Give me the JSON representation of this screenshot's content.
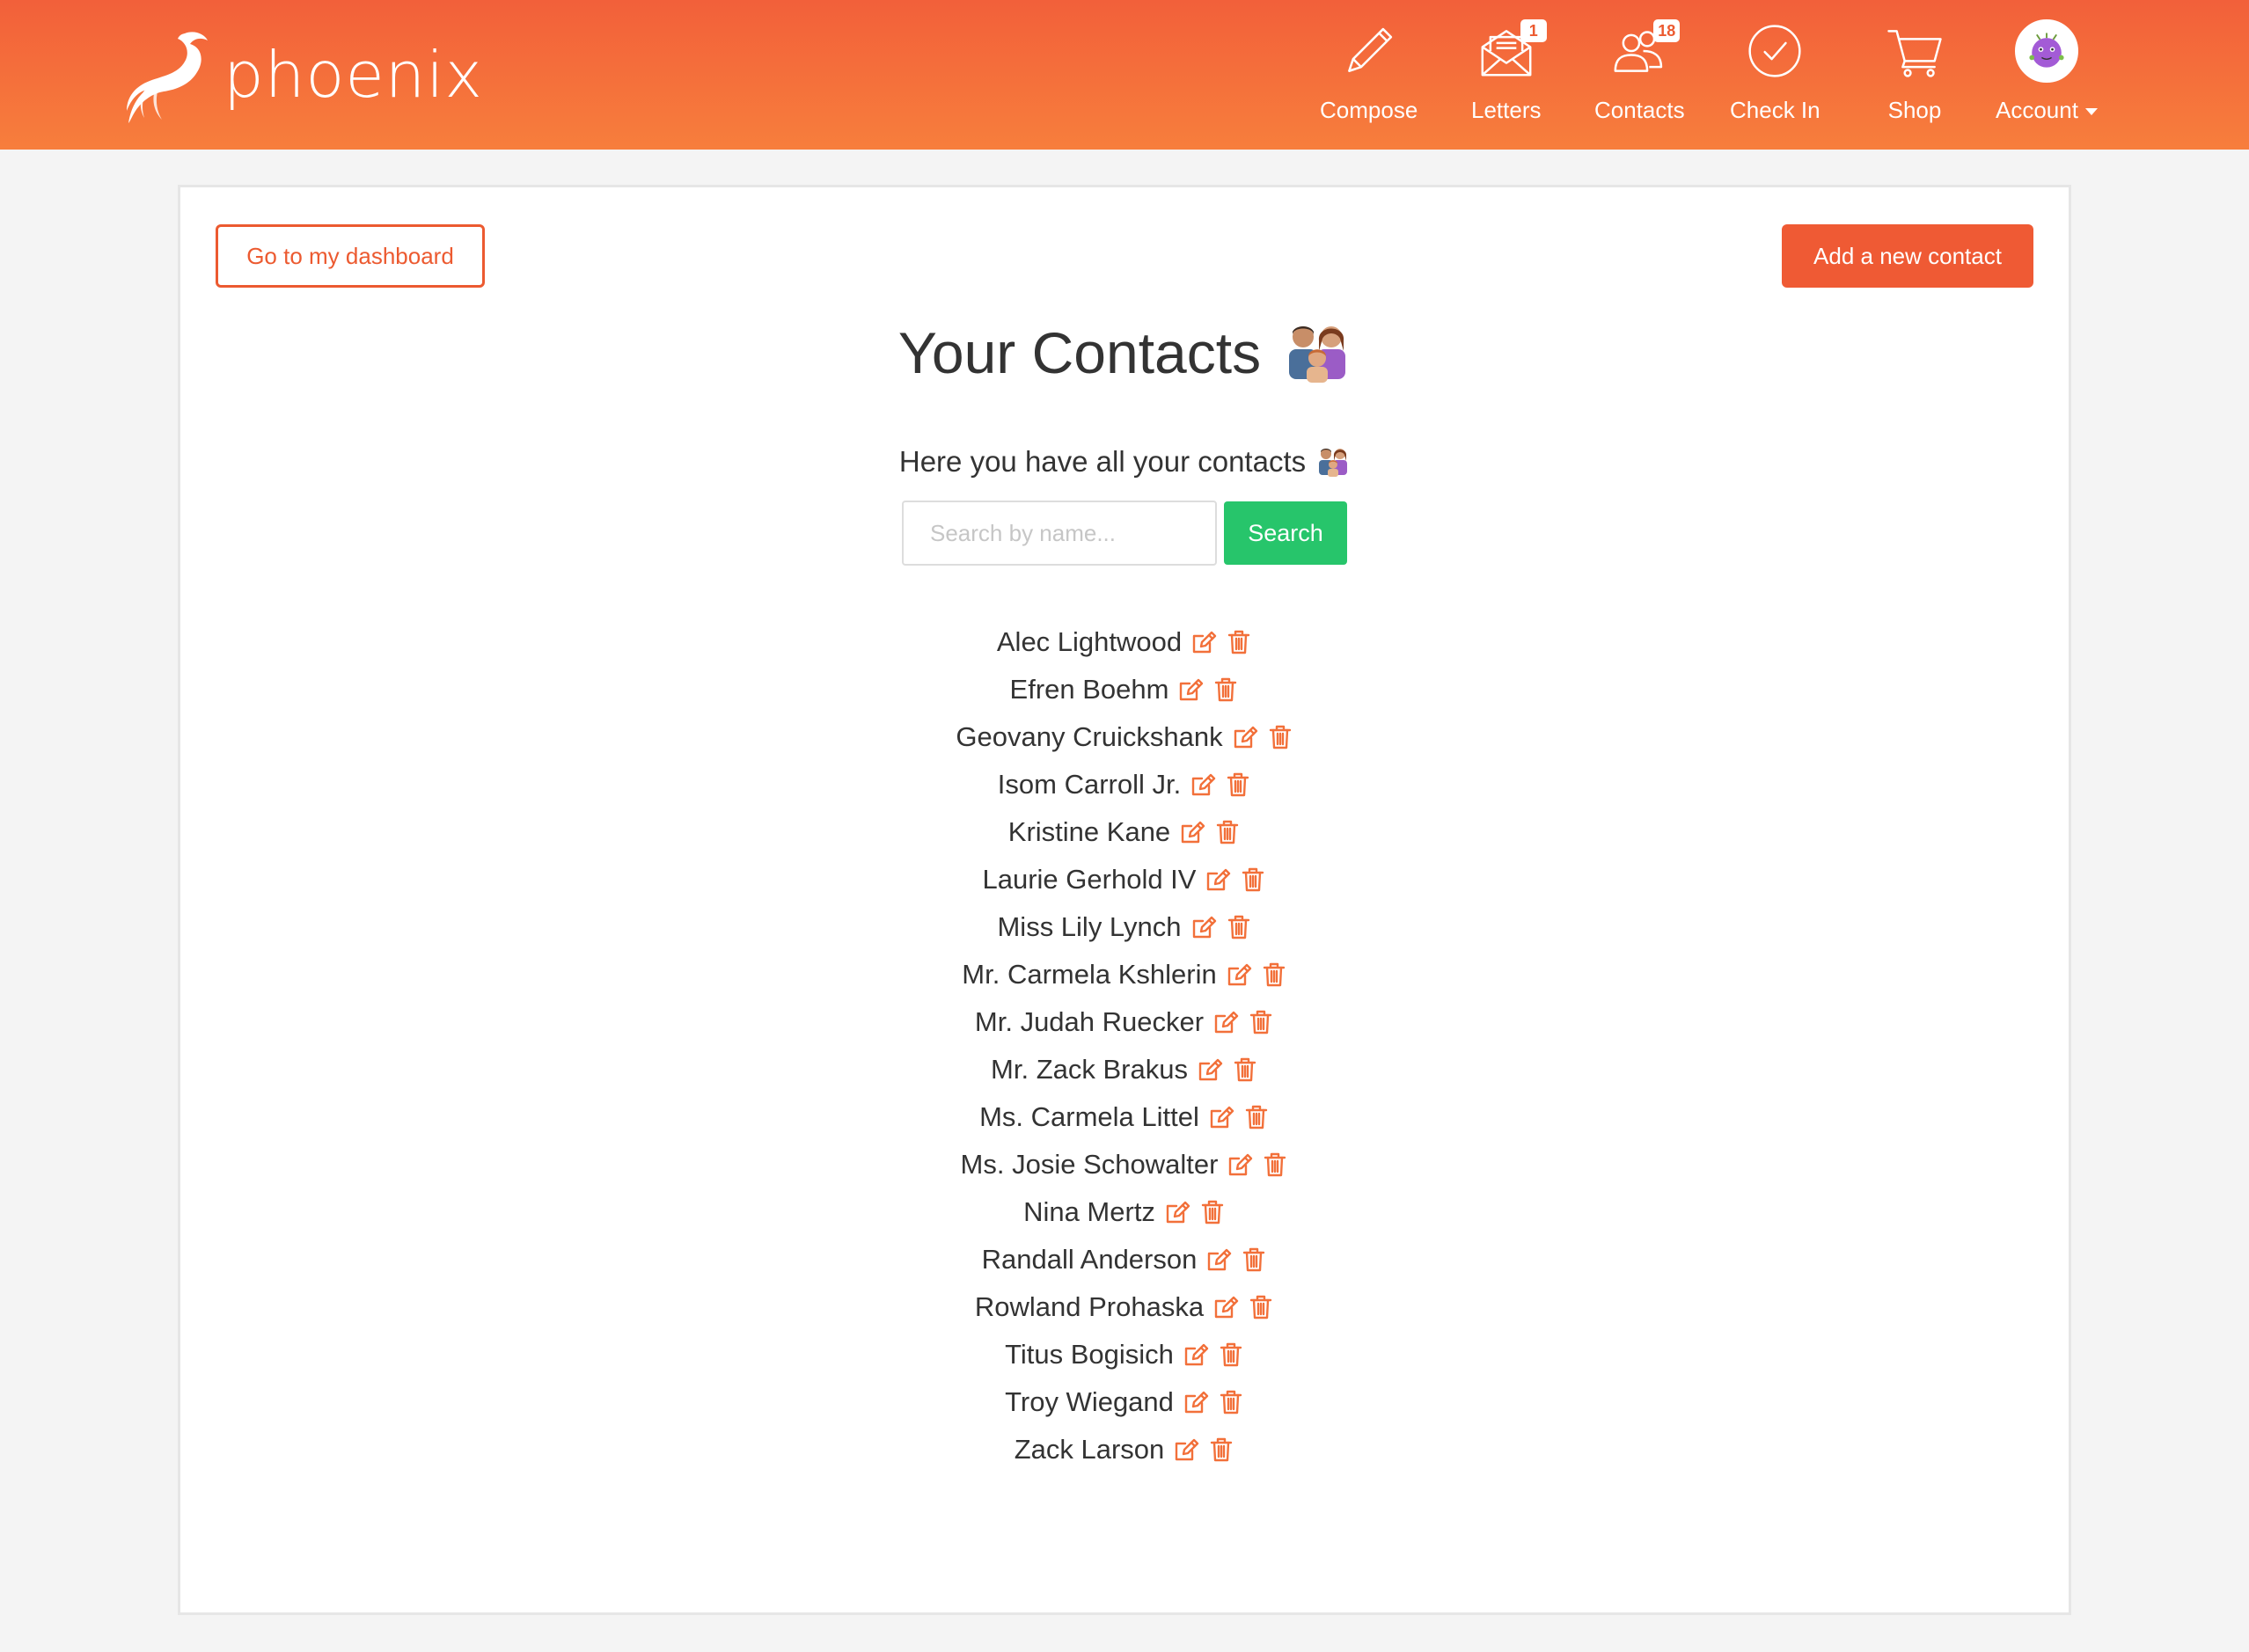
{
  "brand": {
    "name": "phoenix",
    "accent_color": "#f2603a",
    "bird_icon": "phoenix-bird-icon"
  },
  "nav": {
    "compose": {
      "label": "Compose",
      "icon": "pencil-icon"
    },
    "letters": {
      "label": "Letters",
      "icon": "envelope-icon",
      "badge": "1"
    },
    "contacts": {
      "label": "Contacts",
      "icon": "people-icon",
      "badge": "18"
    },
    "checkin": {
      "label": "Check In",
      "icon": "check-circle-icon"
    },
    "shop": {
      "label": "Shop",
      "icon": "cart-icon"
    },
    "account": {
      "label": "Account",
      "icon": "avatar-icon"
    }
  },
  "page": {
    "dashboard_button": "Go to my dashboard",
    "add_contact_button": "Add a new contact",
    "title": "Your Contacts",
    "subtitle": "Here you have all your contacts",
    "title_emoji": "family-emoji-icon"
  },
  "search": {
    "placeholder": "Search by name...",
    "value": "",
    "button_label": "Search",
    "button_color": "#27c56b"
  },
  "contacts": [
    {
      "name": "Alec Lightwood"
    },
    {
      "name": "Efren Boehm"
    },
    {
      "name": "Geovany Cruickshank"
    },
    {
      "name": "Isom Carroll Jr."
    },
    {
      "name": "Kristine Kane"
    },
    {
      "name": "Laurie Gerhold IV"
    },
    {
      "name": "Miss Lily Lynch"
    },
    {
      "name": "Mr. Carmela Kshlerin"
    },
    {
      "name": "Mr. Judah Ruecker"
    },
    {
      "name": "Mr. Zack Brakus"
    },
    {
      "name": "Ms. Carmela Littel"
    },
    {
      "name": "Ms. Josie Schowalter"
    },
    {
      "name": "Nina Mertz"
    },
    {
      "name": "Randall Anderson"
    },
    {
      "name": "Rowland Prohaska"
    },
    {
      "name": "Titus Bogisich"
    },
    {
      "name": "Troy Wiegand"
    },
    {
      "name": "Zack Larson"
    }
  ],
  "row_icons": {
    "edit": "edit-icon",
    "delete": "trash-icon",
    "color": "#f2703a"
  }
}
